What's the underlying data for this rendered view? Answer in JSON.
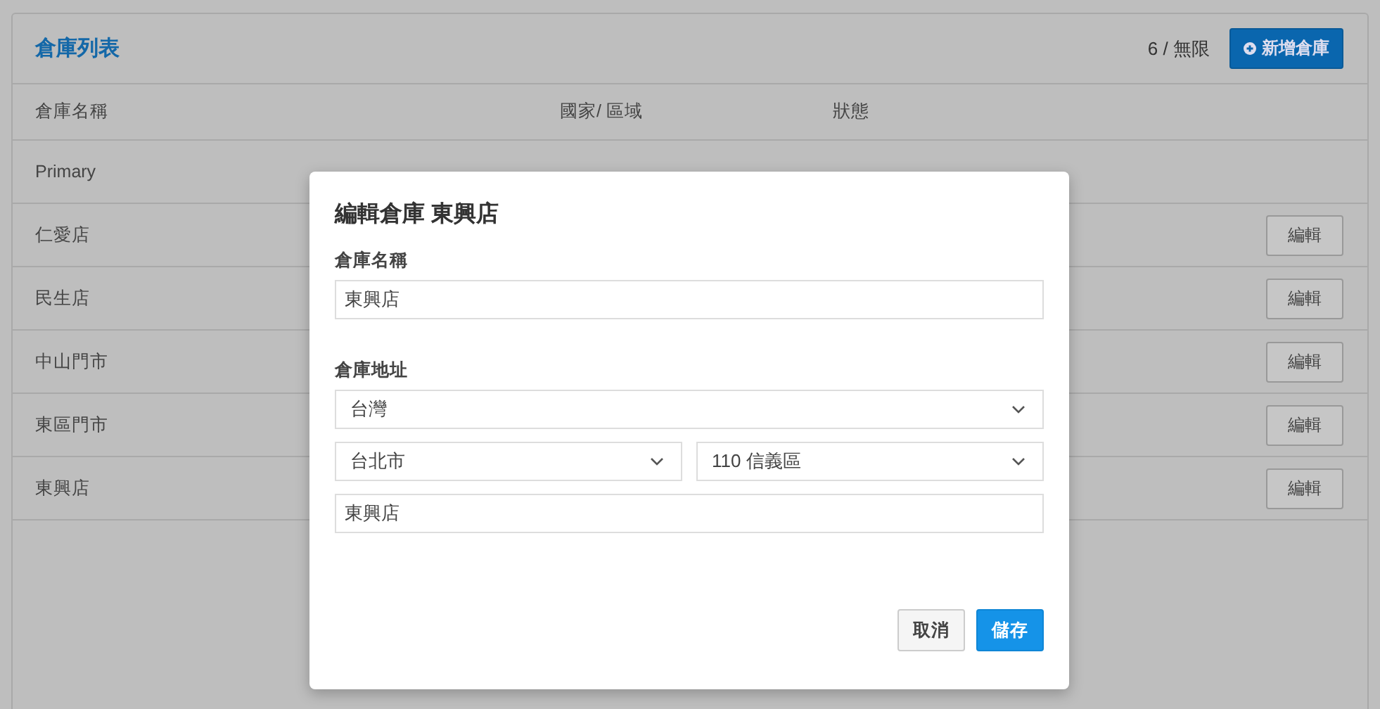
{
  "panel": {
    "title": "倉庫列表",
    "count": "6 / 無限",
    "add_button": "新增倉庫"
  },
  "table": {
    "columns": [
      "倉庫名稱",
      "國家/ 區域",
      "狀態"
    ],
    "rows": [
      {
        "name": "Primary"
      },
      {
        "name": "仁愛店",
        "action": "編輯"
      },
      {
        "name": "民生店",
        "action": "編輯"
      },
      {
        "name": "中山門市",
        "action": "編輯"
      },
      {
        "name": "東區門市",
        "action": "編輯"
      },
      {
        "name": "東興店",
        "action": "編輯"
      }
    ]
  },
  "dialog": {
    "title": "編輯倉庫 東興店",
    "sections": [
      {
        "label": "倉庫名稱",
        "fields": [
          [
            {
              "kind": "input",
              "value": "東興店"
            }
          ]
        ]
      },
      {
        "label": "倉庫地址",
        "fields": [
          [
            {
              "kind": "select",
              "value": "台灣"
            }
          ],
          [
            {
              "kind": "select",
              "value": "台北市"
            },
            {
              "kind": "select",
              "value": "110 信義區"
            }
          ],
          [
            {
              "kind": "input",
              "value": "東興店"
            }
          ]
        ]
      }
    ],
    "buttons": [
      {
        "label": "取消",
        "kind": "secondary"
      },
      {
        "label": "儲存",
        "kind": "primary"
      }
    ]
  }
}
